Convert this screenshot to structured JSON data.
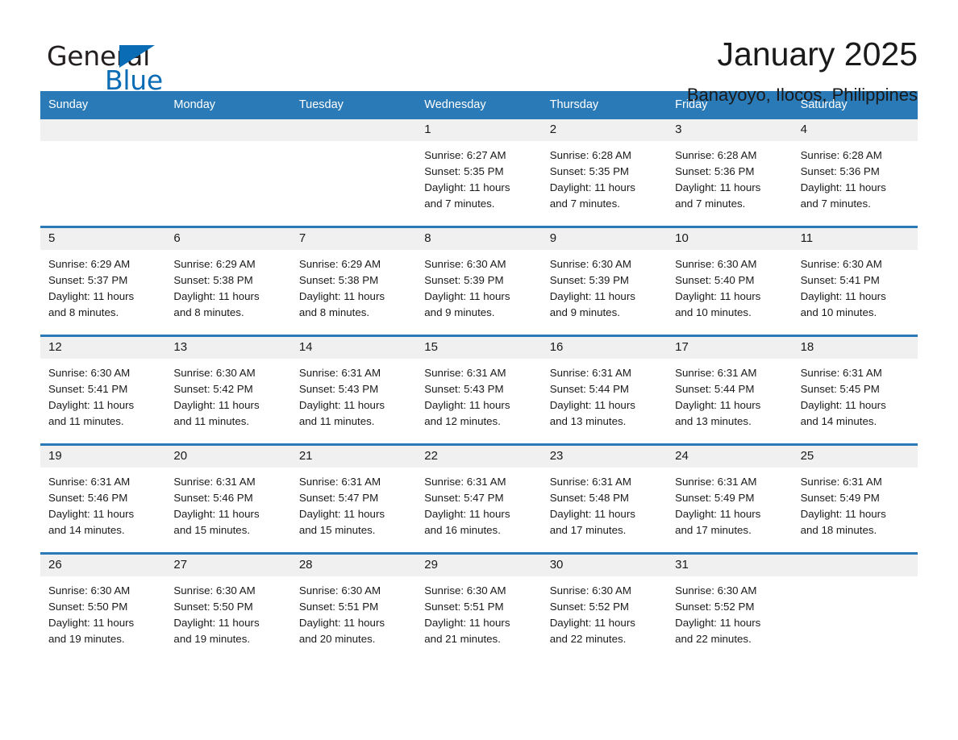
{
  "logo": {
    "word1": "General",
    "word2": "Blue",
    "triangle_color": "#0a6cb4"
  },
  "header": {
    "title": "January 2025",
    "subtitle": "Banayoyo, Ilocos, Philippines"
  },
  "theme": {
    "header_blue": "#2b7ab8",
    "date_band_gray": "#f0f0f0",
    "text": "#1a1a1a"
  },
  "weekdays": [
    "Sunday",
    "Monday",
    "Tuesday",
    "Wednesday",
    "Thursday",
    "Friday",
    "Saturday"
  ],
  "weeks": [
    [
      {
        "day": "",
        "empty": true
      },
      {
        "day": "",
        "empty": true
      },
      {
        "day": "",
        "empty": true
      },
      {
        "day": "1",
        "sunrise": "Sunrise: 6:27 AM",
        "sunset": "Sunset: 5:35 PM",
        "daylight1": "Daylight: 11 hours",
        "daylight2": "and 7 minutes."
      },
      {
        "day": "2",
        "sunrise": "Sunrise: 6:28 AM",
        "sunset": "Sunset: 5:35 PM",
        "daylight1": "Daylight: 11 hours",
        "daylight2": "and 7 minutes."
      },
      {
        "day": "3",
        "sunrise": "Sunrise: 6:28 AM",
        "sunset": "Sunset: 5:36 PM",
        "daylight1": "Daylight: 11 hours",
        "daylight2": "and 7 minutes."
      },
      {
        "day": "4",
        "sunrise": "Sunrise: 6:28 AM",
        "sunset": "Sunset: 5:36 PM",
        "daylight1": "Daylight: 11 hours",
        "daylight2": "and 7 minutes."
      }
    ],
    [
      {
        "day": "5",
        "sunrise": "Sunrise: 6:29 AM",
        "sunset": "Sunset: 5:37 PM",
        "daylight1": "Daylight: 11 hours",
        "daylight2": "and 8 minutes."
      },
      {
        "day": "6",
        "sunrise": "Sunrise: 6:29 AM",
        "sunset": "Sunset: 5:38 PM",
        "daylight1": "Daylight: 11 hours",
        "daylight2": "and 8 minutes."
      },
      {
        "day": "7",
        "sunrise": "Sunrise: 6:29 AM",
        "sunset": "Sunset: 5:38 PM",
        "daylight1": "Daylight: 11 hours",
        "daylight2": "and 8 minutes."
      },
      {
        "day": "8",
        "sunrise": "Sunrise: 6:30 AM",
        "sunset": "Sunset: 5:39 PM",
        "daylight1": "Daylight: 11 hours",
        "daylight2": "and 9 minutes."
      },
      {
        "day": "9",
        "sunrise": "Sunrise: 6:30 AM",
        "sunset": "Sunset: 5:39 PM",
        "daylight1": "Daylight: 11 hours",
        "daylight2": "and 9 minutes."
      },
      {
        "day": "10",
        "sunrise": "Sunrise: 6:30 AM",
        "sunset": "Sunset: 5:40 PM",
        "daylight1": "Daylight: 11 hours",
        "daylight2": "and 10 minutes."
      },
      {
        "day": "11",
        "sunrise": "Sunrise: 6:30 AM",
        "sunset": "Sunset: 5:41 PM",
        "daylight1": "Daylight: 11 hours",
        "daylight2": "and 10 minutes."
      }
    ],
    [
      {
        "day": "12",
        "sunrise": "Sunrise: 6:30 AM",
        "sunset": "Sunset: 5:41 PM",
        "daylight1": "Daylight: 11 hours",
        "daylight2": "and 11 minutes."
      },
      {
        "day": "13",
        "sunrise": "Sunrise: 6:30 AM",
        "sunset": "Sunset: 5:42 PM",
        "daylight1": "Daylight: 11 hours",
        "daylight2": "and 11 minutes."
      },
      {
        "day": "14",
        "sunrise": "Sunrise: 6:31 AM",
        "sunset": "Sunset: 5:43 PM",
        "daylight1": "Daylight: 11 hours",
        "daylight2": "and 11 minutes."
      },
      {
        "day": "15",
        "sunrise": "Sunrise: 6:31 AM",
        "sunset": "Sunset: 5:43 PM",
        "daylight1": "Daylight: 11 hours",
        "daylight2": "and 12 minutes."
      },
      {
        "day": "16",
        "sunrise": "Sunrise: 6:31 AM",
        "sunset": "Sunset: 5:44 PM",
        "daylight1": "Daylight: 11 hours",
        "daylight2": "and 13 minutes."
      },
      {
        "day": "17",
        "sunrise": "Sunrise: 6:31 AM",
        "sunset": "Sunset: 5:44 PM",
        "daylight1": "Daylight: 11 hours",
        "daylight2": "and 13 minutes."
      },
      {
        "day": "18",
        "sunrise": "Sunrise: 6:31 AM",
        "sunset": "Sunset: 5:45 PM",
        "daylight1": "Daylight: 11 hours",
        "daylight2": "and 14 minutes."
      }
    ],
    [
      {
        "day": "19",
        "sunrise": "Sunrise: 6:31 AM",
        "sunset": "Sunset: 5:46 PM",
        "daylight1": "Daylight: 11 hours",
        "daylight2": "and 14 minutes."
      },
      {
        "day": "20",
        "sunrise": "Sunrise: 6:31 AM",
        "sunset": "Sunset: 5:46 PM",
        "daylight1": "Daylight: 11 hours",
        "daylight2": "and 15 minutes."
      },
      {
        "day": "21",
        "sunrise": "Sunrise: 6:31 AM",
        "sunset": "Sunset: 5:47 PM",
        "daylight1": "Daylight: 11 hours",
        "daylight2": "and 15 minutes."
      },
      {
        "day": "22",
        "sunrise": "Sunrise: 6:31 AM",
        "sunset": "Sunset: 5:47 PM",
        "daylight1": "Daylight: 11 hours",
        "daylight2": "and 16 minutes."
      },
      {
        "day": "23",
        "sunrise": "Sunrise: 6:31 AM",
        "sunset": "Sunset: 5:48 PM",
        "daylight1": "Daylight: 11 hours",
        "daylight2": "and 17 minutes."
      },
      {
        "day": "24",
        "sunrise": "Sunrise: 6:31 AM",
        "sunset": "Sunset: 5:49 PM",
        "daylight1": "Daylight: 11 hours",
        "daylight2": "and 17 minutes."
      },
      {
        "day": "25",
        "sunrise": "Sunrise: 6:31 AM",
        "sunset": "Sunset: 5:49 PM",
        "daylight1": "Daylight: 11 hours",
        "daylight2": "and 18 minutes."
      }
    ],
    [
      {
        "day": "26",
        "sunrise": "Sunrise: 6:30 AM",
        "sunset": "Sunset: 5:50 PM",
        "daylight1": "Daylight: 11 hours",
        "daylight2": "and 19 minutes."
      },
      {
        "day": "27",
        "sunrise": "Sunrise: 6:30 AM",
        "sunset": "Sunset: 5:50 PM",
        "daylight1": "Daylight: 11 hours",
        "daylight2": "and 19 minutes."
      },
      {
        "day": "28",
        "sunrise": "Sunrise: 6:30 AM",
        "sunset": "Sunset: 5:51 PM",
        "daylight1": "Daylight: 11 hours",
        "daylight2": "and 20 minutes."
      },
      {
        "day": "29",
        "sunrise": "Sunrise: 6:30 AM",
        "sunset": "Sunset: 5:51 PM",
        "daylight1": "Daylight: 11 hours",
        "daylight2": "and 21 minutes."
      },
      {
        "day": "30",
        "sunrise": "Sunrise: 6:30 AM",
        "sunset": "Sunset: 5:52 PM",
        "daylight1": "Daylight: 11 hours",
        "daylight2": "and 22 minutes."
      },
      {
        "day": "31",
        "sunrise": "Sunrise: 6:30 AM",
        "sunset": "Sunset: 5:52 PM",
        "daylight1": "Daylight: 11 hours",
        "daylight2": "and 22 minutes."
      },
      {
        "day": "",
        "empty": true
      }
    ]
  ]
}
